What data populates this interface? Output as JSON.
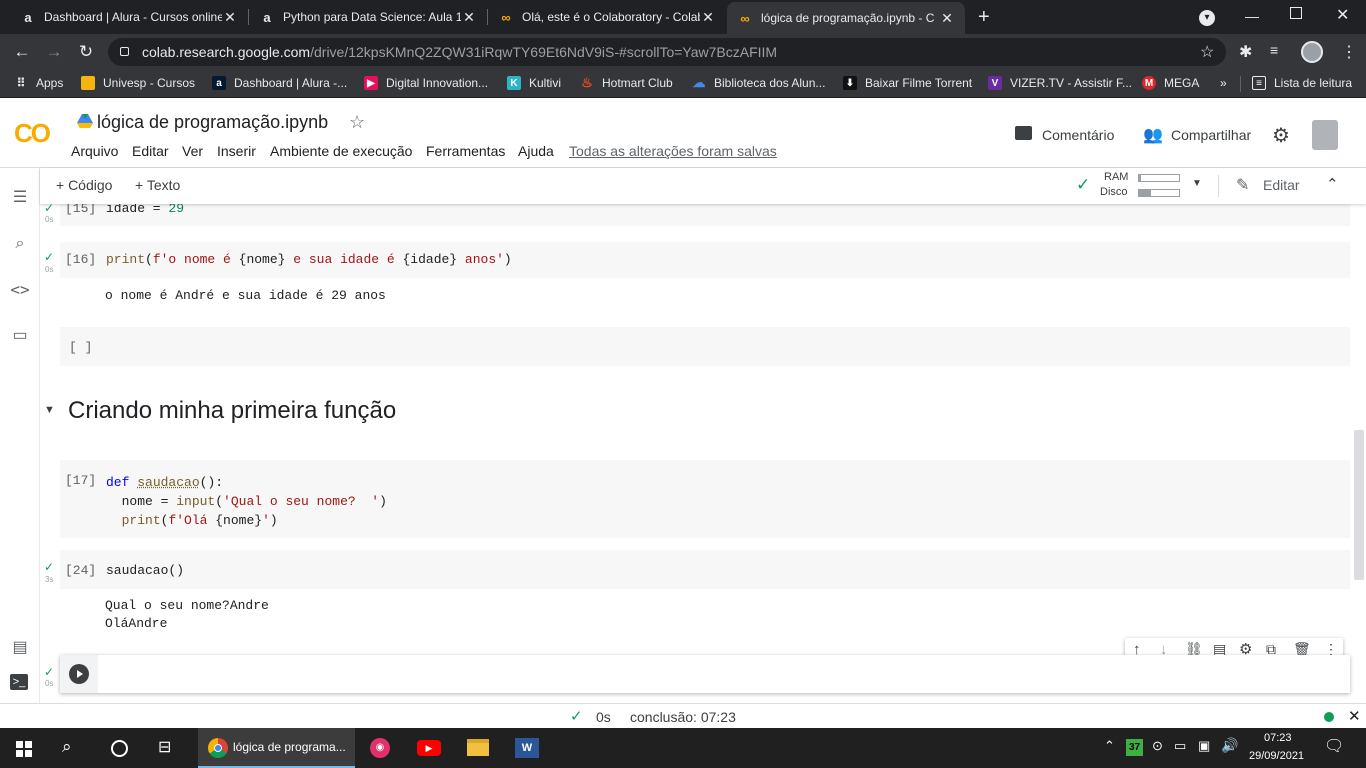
{
  "browser": {
    "tabs": [
      {
        "title": "Dashboard | Alura - Cursos online",
        "icon": "alura-icon"
      },
      {
        "title": "Python para Data Science: Aula 1",
        "icon": "alura-icon"
      },
      {
        "title": "Olá, este é o Colaboratory - Colab",
        "icon": "colab-icon"
      },
      {
        "title": "lógica de programação.ipynb - C",
        "icon": "colab-icon"
      }
    ],
    "url_host": "colab.research.google.com",
    "url_path": "/drive/12kpsKMnQ2ZQW31iRqwTY69Et6NdV9iS-#scrollTo=Yaw7BczAFIIM",
    "bookmarks": [
      {
        "label": "Apps"
      },
      {
        "label": "Univesp - Cursos"
      },
      {
        "label": "Dashboard | Alura -..."
      },
      {
        "label": "Digital Innovation..."
      },
      {
        "label": "Kultivi"
      },
      {
        "label": "Hotmart Club"
      },
      {
        "label": "Biblioteca dos Alun..."
      },
      {
        "label": "Baixar Filme Torrent"
      },
      {
        "label": "VIZER.TV - Assistir F..."
      },
      {
        "label": "MEGA"
      },
      {
        "label": "Lista de leitura"
      }
    ],
    "more_bookmarks": "»"
  },
  "colab": {
    "logo": "CO",
    "title": "lógica de programação.ipynb",
    "menu": [
      "Arquivo",
      "Editar",
      "Ver",
      "Inserir",
      "Ambiente de execução",
      "Ferramentas",
      "Ajuda"
    ],
    "saved_status": "Todas as alterações foram salvas",
    "comment_label": "Comentário",
    "share_label": "Compartilhar",
    "add_code": "+ Código",
    "add_text": "+ Texto",
    "ram_label": "RAM",
    "disk_label": "Disco",
    "ram_level": 0.05,
    "disk_level": 0.3,
    "edit_label": "Editar"
  },
  "cells": {
    "c15": {
      "prompt": "[15]",
      "time": "0s"
    },
    "c16": {
      "prompt": "[16]",
      "time": "0s",
      "output": "o nome é André e sua idade é 29 anos"
    },
    "empty_prompt": "[ ]",
    "section_title": "Criando minha primeira função",
    "c17": {
      "prompt": "[17]"
    },
    "c24": {
      "prompt": "[24]",
      "time": "3s",
      "code": "saudacao()",
      "output1": "Qual o seu nome?Andre",
      "output2": "OláAndre"
    },
    "last": {
      "time": "0s"
    }
  },
  "status": {
    "time": "0s",
    "conclusion": "conclusão: 07:23"
  },
  "taskbar": {
    "chrome_label": "lógica de programa...",
    "badge": "37",
    "clock_time": "07:23",
    "clock_date": "29/09/2021"
  }
}
